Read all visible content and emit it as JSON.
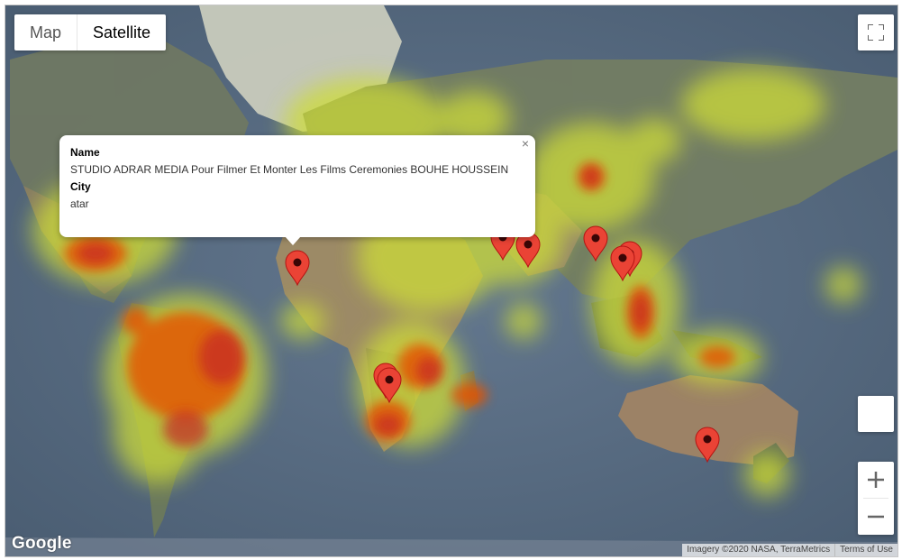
{
  "map": {
    "type_buttons": [
      "Map",
      "Satellite"
    ],
    "active_type": "Satellite",
    "infowindow": {
      "name_label": "Name",
      "name_value": "STUDIO ADRAR MEDIA Pour Filmer Et Monter Les Films Ceremonies BOUHE HOUSSEIN",
      "city_label": "City",
      "city_value": "atar",
      "close_glyph": "×"
    },
    "logo": "Google",
    "attribution": "Imagery ©2020 NASA, TerraMetrics",
    "terms": "Terms of Use",
    "icons": [
      "fullscreen-icon",
      "zoom-in-icon",
      "zoom-out-icon",
      "map-marker-icon",
      "close-icon"
    ],
    "colors": {
      "ocean": "#566a80",
      "marker": "#ea4335",
      "heat_low": "#cddc39",
      "heat_high": "#d32f2f"
    }
  }
}
